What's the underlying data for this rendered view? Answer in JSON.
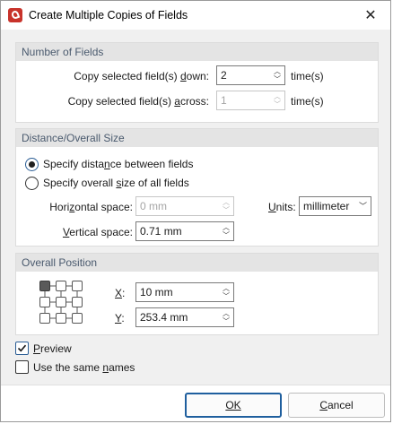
{
  "window": {
    "title": "Create Multiple Copies of Fields",
    "app_icon": "pdf-editor-logo-icon",
    "close_glyph": "✕"
  },
  "number_of_fields": {
    "header": "Number of Fields",
    "down_label": "Copy selected field(s) down:",
    "down_value": "2",
    "down_suffix": "time(s)",
    "across_label": "Copy selected field(s) across:",
    "across_value": "1",
    "across_suffix": "time(s)"
  },
  "distance": {
    "header": "Distance/Overall Size",
    "option_distance": "Specify distance between fields",
    "option_overall": "Specify overall size of all fields",
    "selected": "distance",
    "horizontal_label": "Horizontal space:",
    "horizontal_value": "0 mm",
    "vertical_label": "Vertical space:",
    "vertical_value": "0.71 mm",
    "units_label": "Units:",
    "units_value": "millimeter"
  },
  "overall_position": {
    "header": "Overall Position",
    "x_label": "X:",
    "x_value": "10 mm",
    "y_label": "Y:",
    "y_value": "253.4 mm",
    "anchor": "top-left"
  },
  "options": {
    "preview_label": "Preview",
    "preview_checked": true,
    "same_names_label": "Use the same names",
    "same_names_checked": false
  },
  "buttons": {
    "ok": "OK",
    "cancel": "Cancel"
  },
  "colors": {
    "accent": "#1f5f9e",
    "header_bg": "#e4e4e4",
    "header_text": "#4a5a6e",
    "dialog_bg": "#f0f0f0"
  }
}
